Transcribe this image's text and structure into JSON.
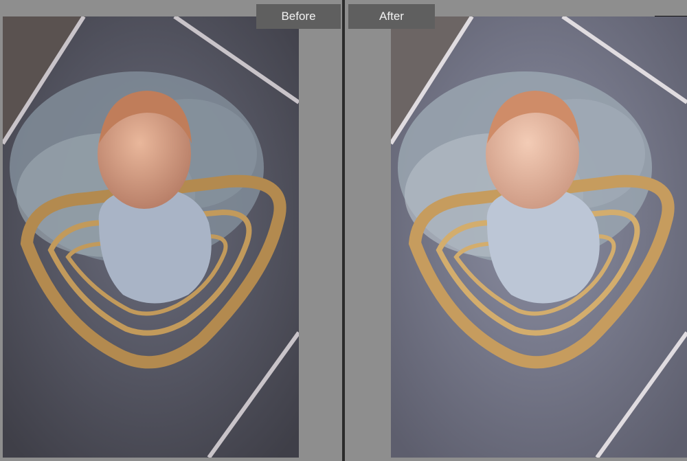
{
  "compare_view": {
    "before_label": "Before",
    "after_label": "After"
  },
  "photo": {
    "subject": "newborn-in-basket-icon"
  },
  "colors": {
    "background": "#8e8e8e",
    "label_bg": "#5f5f5f",
    "label_text": "#f2f2f2",
    "divider": "#2b2b2b"
  }
}
